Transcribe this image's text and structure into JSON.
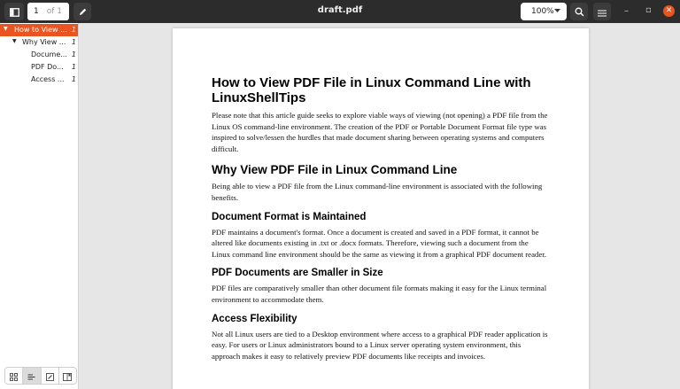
{
  "header": {
    "title": "draft.pdf",
    "page_current": "1",
    "page_total": "of 1",
    "zoom": "100%"
  },
  "icons": {
    "sidebar_toggle": "sidebar-toggle-icon",
    "annotate": "pencil-icon",
    "zoom_dropdown": "caret-down-icon",
    "search": "search-icon",
    "menu": "hamburger-icon",
    "minimize": "minimize-icon",
    "maximize": "restore-icon",
    "close": "close-icon",
    "thumbnails": "grid-icon",
    "outline": "outline-icon",
    "annotations": "annotations-icon",
    "bookmarks": "bookmarks-icon"
  },
  "window_controls": {
    "minimize": "–",
    "restore": "▫",
    "close": "✕"
  },
  "sidebar": {
    "outline": [
      {
        "label": "How to View ...",
        "page": "1"
      },
      {
        "label": "Why View ...",
        "page": "1"
      },
      {
        "label": "Docume...",
        "page": "1"
      },
      {
        "label": "PDF Do...",
        "page": "1"
      },
      {
        "label": "Access ...",
        "page": "1"
      }
    ]
  },
  "document": {
    "h1": "How to View PDF File in Linux Command Line with LinuxShellTips",
    "intro": "Please note that this article guide seeks to explore viable ways of viewing (not opening) a PDF file from the Linux OS command-line environment. The creation of the PDF or Portable Document Format file type was inspired to solve/lessen the hurdles that made document sharing between operating systems and computers difficult.",
    "h2": "Why View PDF File in Linux Command Line",
    "p2": "Being able to view a PDF file from the Linux command-line environment is associated with the following benefits.",
    "h3a": "Document Format is Maintained",
    "p3a": "PDF maintains a document's format. Once a document is created and saved in a PDF format, it cannot be altered like documents existing in .txt or .docx formats. Therefore, viewing such a document from the Linux command line environment should be the same as viewing it from a graphical PDF document reader.",
    "h3b": "PDF Documents are Smaller in Size",
    "p3b": "PDF files are comparatively smaller than other document file formats making it easy for the Linux terminal environment to accommodate them.",
    "h3c": "Access Flexibility",
    "p3c": "Not all Linux users are tied to a Desktop environment where access to a graphical PDF reader application is easy. For users or Linux administrators bound to a Linux server operating system environment, this approach makes it easy to relatively preview PDF documents like receipts and invoices."
  },
  "colors": {
    "header_bg": "#2c2c2c",
    "accent": "#e95420",
    "viewer_bg": "#e6e6e6"
  }
}
